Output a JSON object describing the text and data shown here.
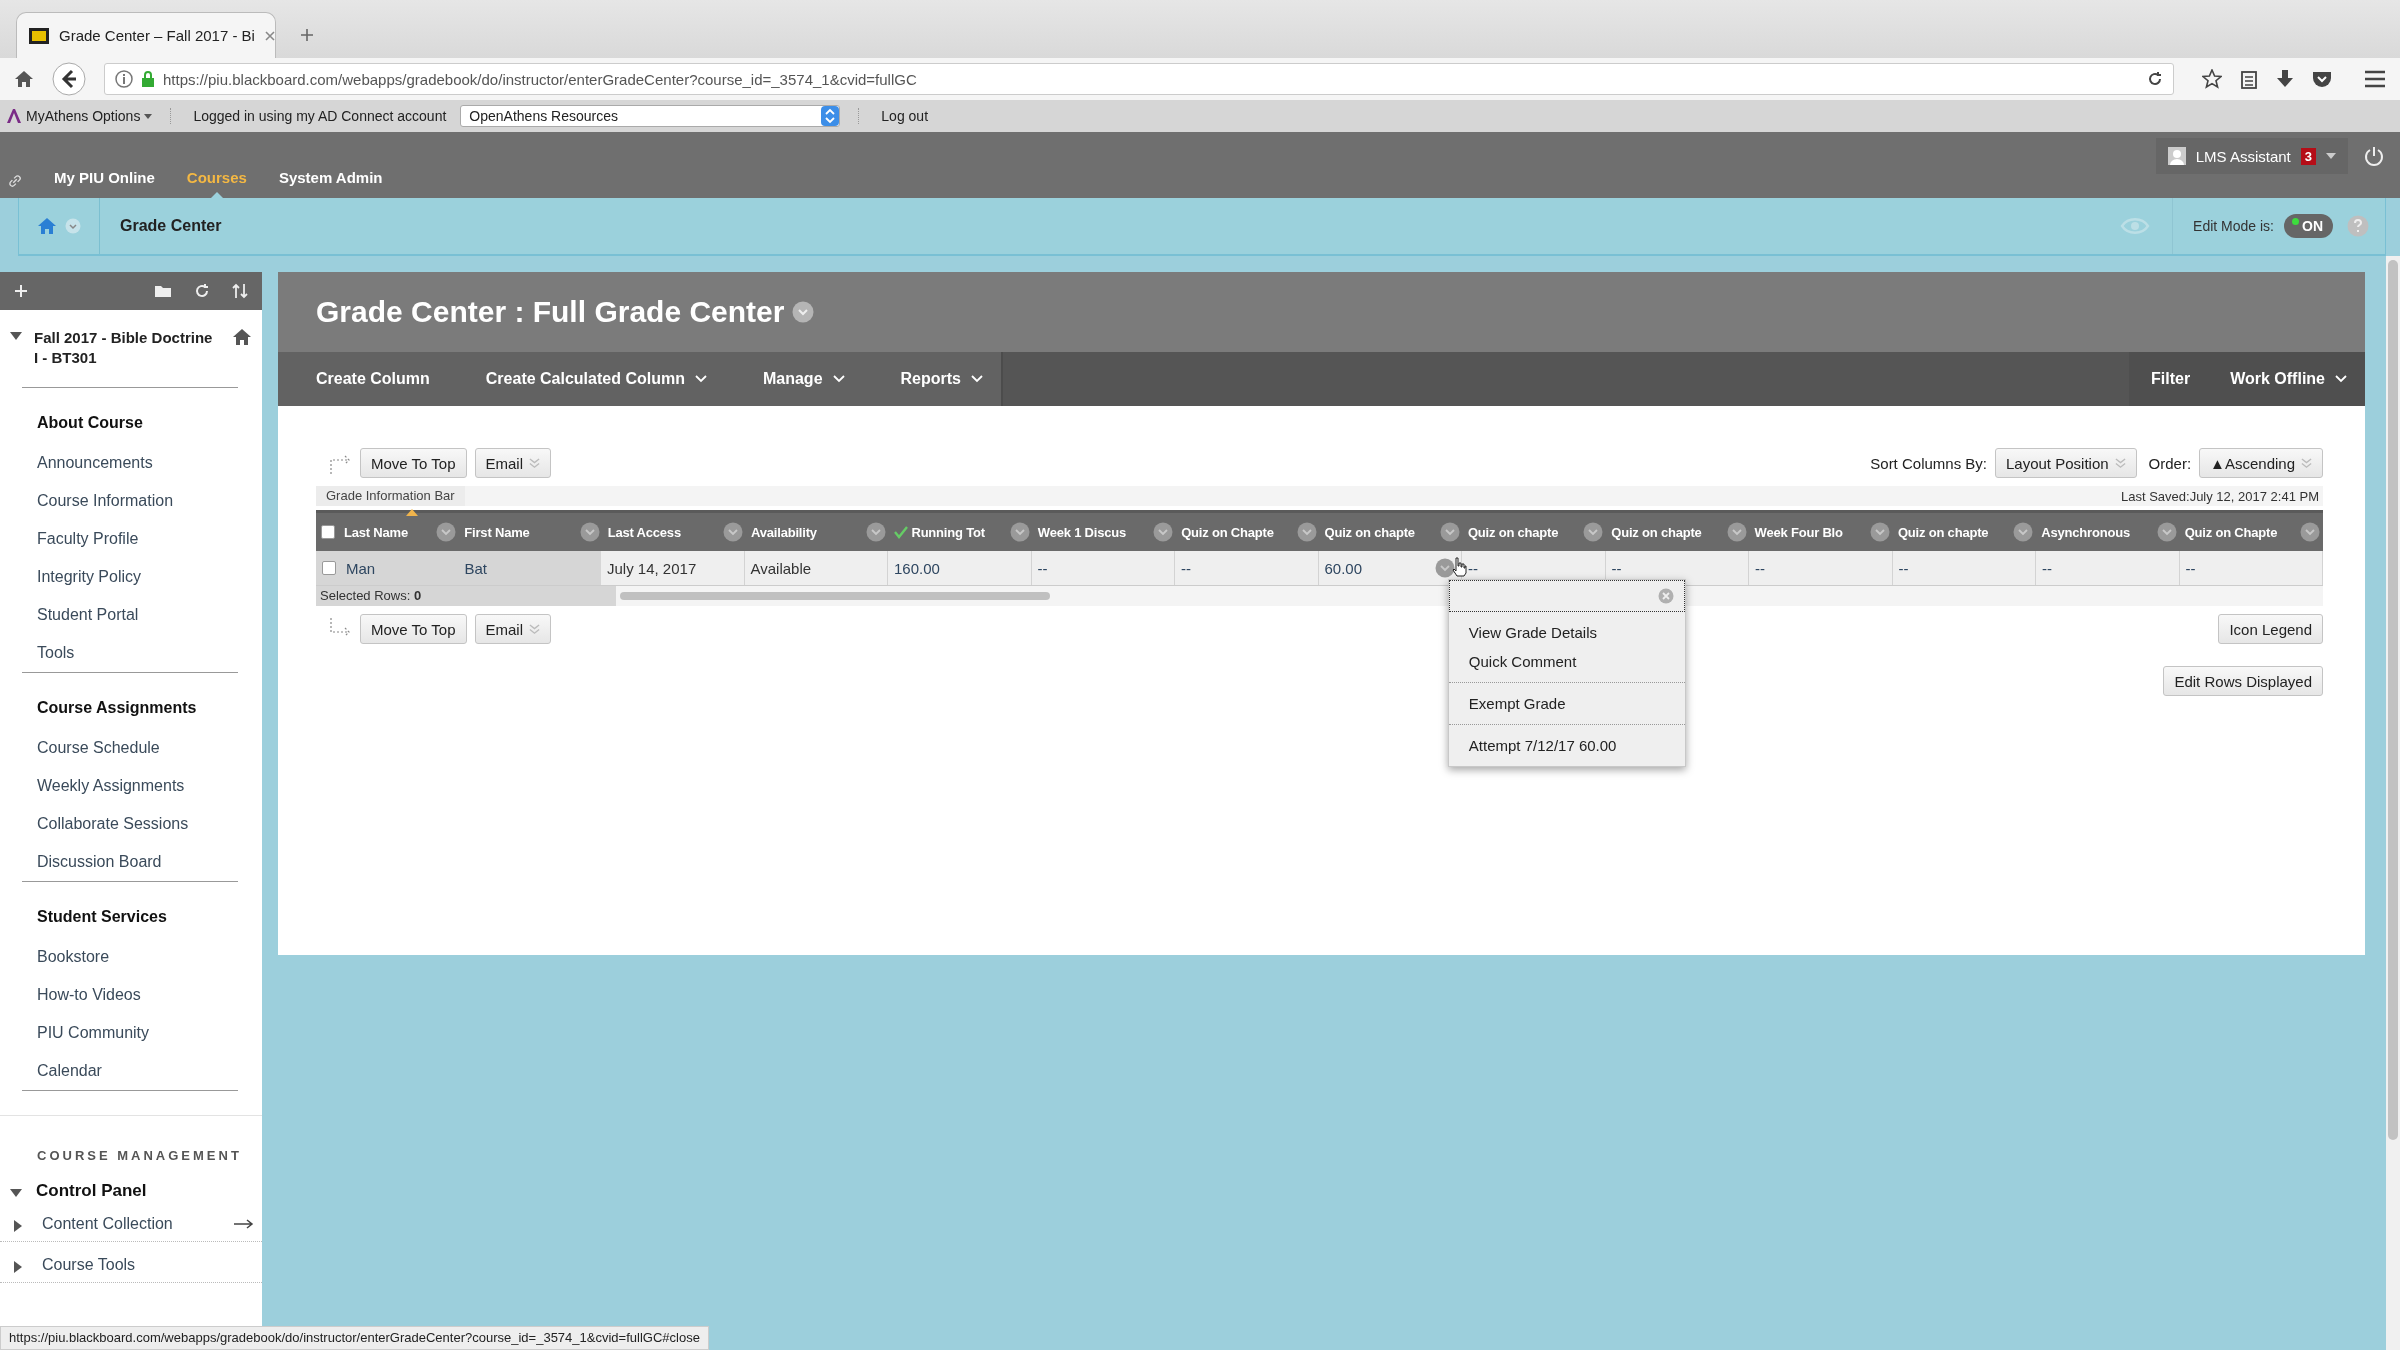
{
  "browser": {
    "tab_title": "Grade Center – Fall 2017 - Bi",
    "url": "https://piu.blackboard.com/webapps/gradebook/do/instructor/enterGradeCenter?course_id=_3574_1&cvid=fullGC",
    "status_url": "https://piu.blackboard.com/webapps/gradebook/do/instructor/enterGradeCenter?course_id=_3574_1&cvid=fullGC#close"
  },
  "athens_bar": {
    "options": "MyAthens Options",
    "logged_in": "Logged in using my AD Connect account",
    "resources": "OpenAthens Resources",
    "logout": "Log out"
  },
  "top_nav": {
    "items": [
      {
        "label": "My PIU Online",
        "selected": false
      },
      {
        "label": "Courses",
        "selected": true
      },
      {
        "label": "System Admin",
        "selected": false
      }
    ],
    "user": "LMS Assistant",
    "badge": "3"
  },
  "breadcrumb": {
    "label": "Grade Center",
    "edit_mode_label": "Edit Mode is:",
    "edit_mode": {
      "label": "ON",
      "on": true
    }
  },
  "sidebar": {
    "course_title": "Fall 2017 - Bible Doctrine I - BT301",
    "sections": [
      {
        "heading": "About Course",
        "items": [
          "Announcements",
          "Course Information",
          "Faculty Profile",
          "Integrity Policy",
          "Student Portal",
          "Tools"
        ]
      },
      {
        "heading": "Course Assignments",
        "items": [
          "Course Schedule",
          "Weekly Assignments",
          "Collaborate Sessions",
          "Discussion Board"
        ]
      },
      {
        "heading": "Student Services",
        "items": [
          "Bookstore",
          "How-to Videos",
          "PIU Community",
          "Calendar"
        ]
      }
    ],
    "management_heading": "COURSE MANAGEMENT",
    "control_panel": {
      "label": "Control Panel",
      "expanded": true,
      "children": [
        {
          "label": "Content Collection",
          "expanded": false,
          "arrow": true
        },
        {
          "label": "Course Tools",
          "expanded": false,
          "arrow": false
        }
      ]
    }
  },
  "page": {
    "title": "Grade Center : Full Grade Center",
    "actions": [
      {
        "label": "Create Column",
        "dropdown": false
      },
      {
        "label": "Create Calculated Column",
        "dropdown": true
      },
      {
        "label": "Manage",
        "dropdown": true
      },
      {
        "label": "Reports",
        "dropdown": true
      }
    ],
    "right_actions": [
      {
        "label": "Filter",
        "dropdown": false
      },
      {
        "label": "Work Offline",
        "dropdown": true
      }
    ],
    "top_buttons": {
      "move_to_top": "Move To Top",
      "email": "Email"
    },
    "bottom_buttons": {
      "move_to_top": "Move To Top",
      "email": "Email"
    },
    "sort_label": "Sort Columns By:",
    "sort_value": "Layout Position",
    "order_label": "Order:",
    "order_value": "▲Ascending",
    "info_bar": "Grade Information Bar",
    "last_saved": "Last Saved:July 12, 2017 2:41 PM",
    "selected_rows": "Selected Rows: **0**",
    "icon_legend": "Icon Legend",
    "edit_rows": "Edit Rows Displayed"
  },
  "table": {
    "select_all": false,
    "columns": [
      {
        "label": "Last Name",
        "sorted": true,
        "checked": false,
        "menu_open": false
      },
      {
        "label": "First Name",
        "sorted": false,
        "checked": false,
        "menu_open": false
      },
      {
        "label": "Last Access",
        "sorted": false,
        "checked": false,
        "menu_open": false
      },
      {
        "label": "Availability",
        "sorted": false,
        "checked": false,
        "menu_open": false
      },
      {
        "label": "Running Tot",
        "sorted": false,
        "checked": true,
        "menu_open": false
      },
      {
        "label": "Week 1 Discus",
        "sorted": false,
        "checked": false,
        "menu_open": false
      },
      {
        "label": "Quiz on Chapte",
        "sorted": false,
        "checked": false,
        "menu_open": false
      },
      {
        "label": "Quiz on chapte",
        "sorted": false,
        "checked": false,
        "menu_open": true
      },
      {
        "label": "Quiz on chapte",
        "sorted": false,
        "checked": false,
        "menu_open": false
      },
      {
        "label": "Quiz on chapte",
        "sorted": false,
        "checked": false,
        "menu_open": false
      },
      {
        "label": "Week Four Blo",
        "sorted": false,
        "checked": false,
        "menu_open": false
      },
      {
        "label": "Quiz on chapte",
        "sorted": false,
        "checked": false,
        "menu_open": false
      },
      {
        "label": "Asynchronous",
        "sorted": false,
        "checked": false,
        "menu_open": false
      },
      {
        "label": "Quiz on Chapte",
        "sorted": false,
        "checked": false,
        "menu_open": false
      }
    ],
    "rows": [
      {
        "selected": false,
        "cells": [
          "Man",
          "Bat",
          "July 14, 2017",
          "Available",
          "160.00",
          "--",
          "--",
          "60.00",
          "--",
          "--",
          "--",
          "--",
          "--",
          "--"
        ]
      }
    ]
  },
  "context_menu": {
    "groups": [
      [
        "View Grade Details",
        "Quick Comment"
      ],
      [
        "Exempt Grade"
      ],
      [
        "Attempt 7/12/17 60.00"
      ]
    ]
  }
}
